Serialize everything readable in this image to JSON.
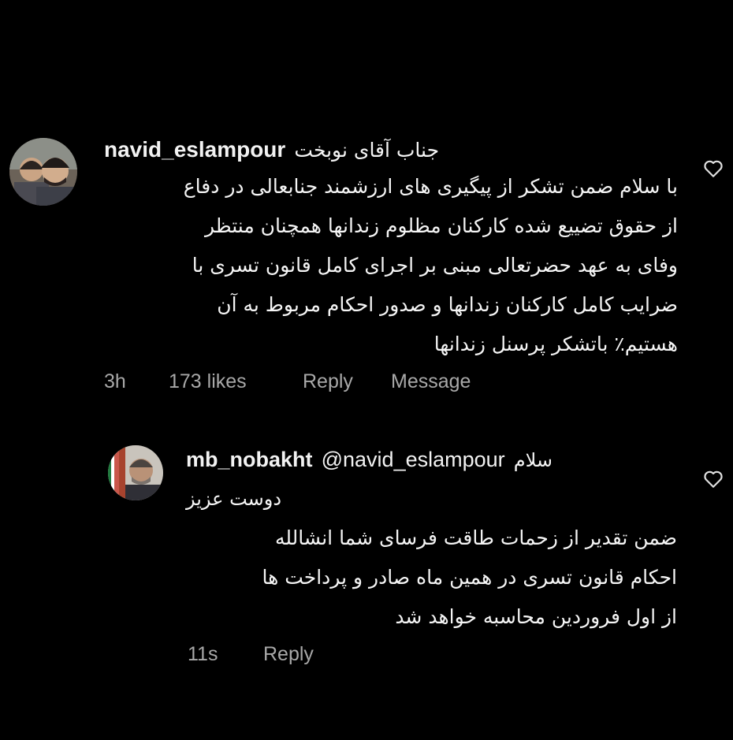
{
  "comments": [
    {
      "username": "navid_eslampour",
      "lines": [
        "جناب آقای نوبخت",
        "با سلام ضمن تشکر از پیگیری های ارزشمند جنابعالی در دفاع",
        "از حقوق تضییع شده کارکنان مظلوم زندانها همچنان منتظر",
        "وفای به عهد حضرتعالی مبنی بر اجرای کامل قانون تسری با",
        "ضرایب کامل کارکنان زندانها و صدور احکام مربوط به آن",
        "هستیم٪ باتشکر پرسنل زندانها"
      ],
      "time": "3h",
      "likes": "173 likes",
      "reply_label": "Reply",
      "message_label": "Message",
      "like_icon": "heart-outline-icon"
    },
    {
      "username": "mb_nobakht",
      "mention": "@navid_eslampour",
      "lines": [
        "سلام",
        "دوست عزیز",
        "ضمن تقدیر از زحمات طاقت فرسای شما انشالله",
        "احکام قانون تسری در همین ماه صادر و پرداخت ها",
        "از اول فروردین  محاسبه خواهد شد"
      ],
      "time": "11s",
      "reply_label": "Reply",
      "like_icon": "heart-outline-icon"
    }
  ]
}
